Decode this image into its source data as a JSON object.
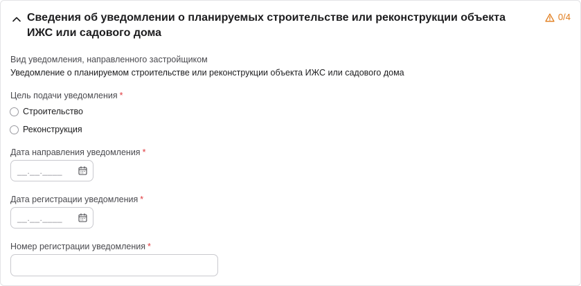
{
  "section": {
    "title": "Сведения об уведомлении о планируемых строительстве или реконструкции объекта ИЖС или садового дома",
    "counter": "0/4",
    "icons": {
      "toggle": "chevron-up-icon",
      "warning": "warning-triangle-icon"
    },
    "accent_color": "#e07b1a",
    "required_color": "#e0393e"
  },
  "notification_type": {
    "label": "Вид уведомления, направленного застройщиком",
    "value": "Уведомление о планируемом строительстве или реконструкции объекта ИЖС или садового дома"
  },
  "purpose": {
    "label": "Цель подачи уведомления",
    "required": "*",
    "options": [
      "Строительство",
      "Реконструкция"
    ]
  },
  "send_date": {
    "label": "Дата направления уведомления",
    "required": "*",
    "placeholder": "__.__.____",
    "icon": "calendar-icon"
  },
  "registration_date": {
    "label": "Дата регистрации уведомления",
    "required": "*",
    "placeholder": "__.__.____",
    "icon": "calendar-icon"
  },
  "registration_number": {
    "label": "Номер регистрации уведомления",
    "required": "*",
    "value": ""
  }
}
